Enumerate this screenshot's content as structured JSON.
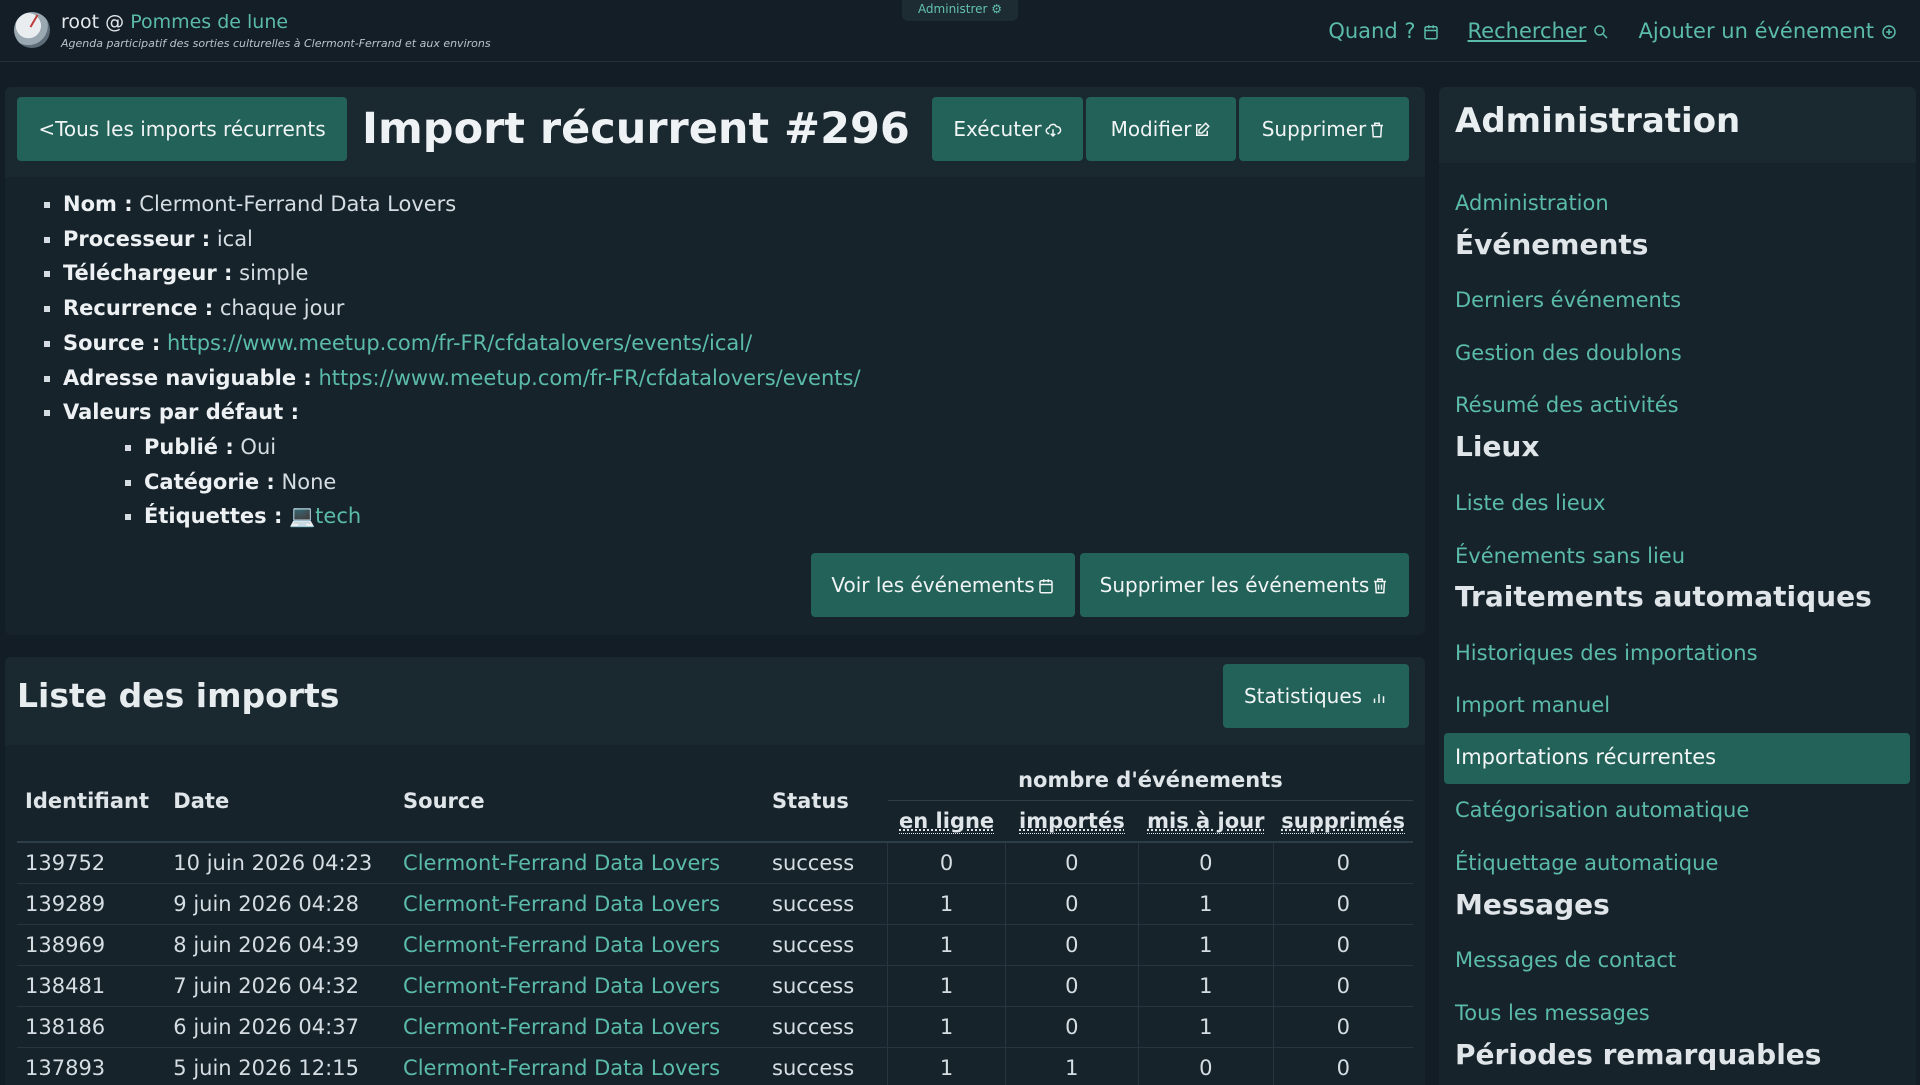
{
  "header": {
    "user": "root @",
    "site_name": "Pommes de lune",
    "tagline": "Agenda participatif des sorties culturelles à Clermont-Ferrand et aux environs",
    "admin_pill": "Administrer",
    "nav": [
      {
        "label": "Quand ?",
        "icon": "calendar-icon"
      },
      {
        "label": "Rechercher",
        "icon": "search-icon"
      },
      {
        "label": "Ajouter un événement",
        "icon": "plus-circle-icon"
      }
    ]
  },
  "import": {
    "back_label": "<Tous les imports récurrents",
    "title": "Import récurrent #296",
    "actions": {
      "run": "Exécuter",
      "edit": "Modifier",
      "delete": "Supprimer"
    },
    "fields": [
      {
        "label": "Nom :",
        "value": "Clermont-Ferrand Data Lovers"
      },
      {
        "label": "Processeur :",
        "value": "ical"
      },
      {
        "label": "Téléchargeur :",
        "value": "simple"
      },
      {
        "label": "Recurrence :",
        "value": "chaque jour"
      },
      {
        "label": "Source :",
        "value": "https://www.meetup.com/fr-FR/cfdatalovers/events/ical/"
      },
      {
        "label": "Adresse naviguable :",
        "value": "https://www.meetup.com/fr-FR/cfdatalovers/events/"
      }
    ],
    "defaults_label": "Valeurs par défaut :",
    "defaults": [
      {
        "label": "Publié :",
        "value": "Oui"
      },
      {
        "label": "Catégorie :",
        "value": "None"
      },
      {
        "label": "Étiquettes :",
        "value": "💻tech"
      }
    ],
    "footer_actions": {
      "view_events": "Voir les événements",
      "delete_events": "Supprimer les événements"
    }
  },
  "imports_list": {
    "title": "Liste des imports",
    "stats_label": "Statistiques",
    "columns": {
      "id": "Identifiant",
      "date": "Date",
      "source": "Source",
      "status": "Status",
      "group": "nombre d'événements",
      "online": "en ligne",
      "imported": "importés",
      "updated": "mis à jour",
      "deleted": "supprimés"
    },
    "rows": [
      {
        "id": "139752",
        "date": "10 juin 2026 04:23",
        "source": "Clermont-Ferrand Data Lovers",
        "status": "success",
        "online": "0",
        "imported": "0",
        "updated": "0",
        "deleted": "0"
      },
      {
        "id": "139289",
        "date": "9 juin 2026 04:28",
        "source": "Clermont-Ferrand Data Lovers",
        "status": "success",
        "online": "1",
        "imported": "0",
        "updated": "1",
        "deleted": "0"
      },
      {
        "id": "138969",
        "date": "8 juin 2026 04:39",
        "source": "Clermont-Ferrand Data Lovers",
        "status": "success",
        "online": "1",
        "imported": "0",
        "updated": "1",
        "deleted": "0"
      },
      {
        "id": "138481",
        "date": "7 juin 2026 04:32",
        "source": "Clermont-Ferrand Data Lovers",
        "status": "success",
        "online": "1",
        "imported": "0",
        "updated": "1",
        "deleted": "0"
      },
      {
        "id": "138186",
        "date": "6 juin 2026 04:37",
        "source": "Clermont-Ferrand Data Lovers",
        "status": "success",
        "online": "1",
        "imported": "0",
        "updated": "1",
        "deleted": "0"
      },
      {
        "id": "137893",
        "date": "5 juin 2026 12:15",
        "source": "Clermont-Ferrand Data Lovers",
        "status": "success",
        "online": "1",
        "imported": "1",
        "updated": "0",
        "deleted": "0"
      }
    ]
  },
  "sidebar": {
    "title": "Administration",
    "admin_link": "Administration",
    "sections": [
      {
        "heading": "Événements",
        "links": [
          "Derniers événements",
          "Gestion des doublons",
          "Résumé des activités"
        ]
      },
      {
        "heading": "Lieux",
        "links": [
          "Liste des lieux",
          "Événements sans lieu"
        ]
      },
      {
        "heading": "Traitements automatiques",
        "links": [
          "Historiques des importations",
          "Import manuel",
          "Importations récurrentes",
          "Catégorisation automatique",
          "Étiquettage automatique"
        ]
      },
      {
        "heading": "Messages",
        "links": [
          "Messages de contact",
          "Tous les messages"
        ]
      },
      {
        "heading": "Périodes remarquables",
        "links": []
      }
    ],
    "active_link": "Importations récurrentes"
  }
}
